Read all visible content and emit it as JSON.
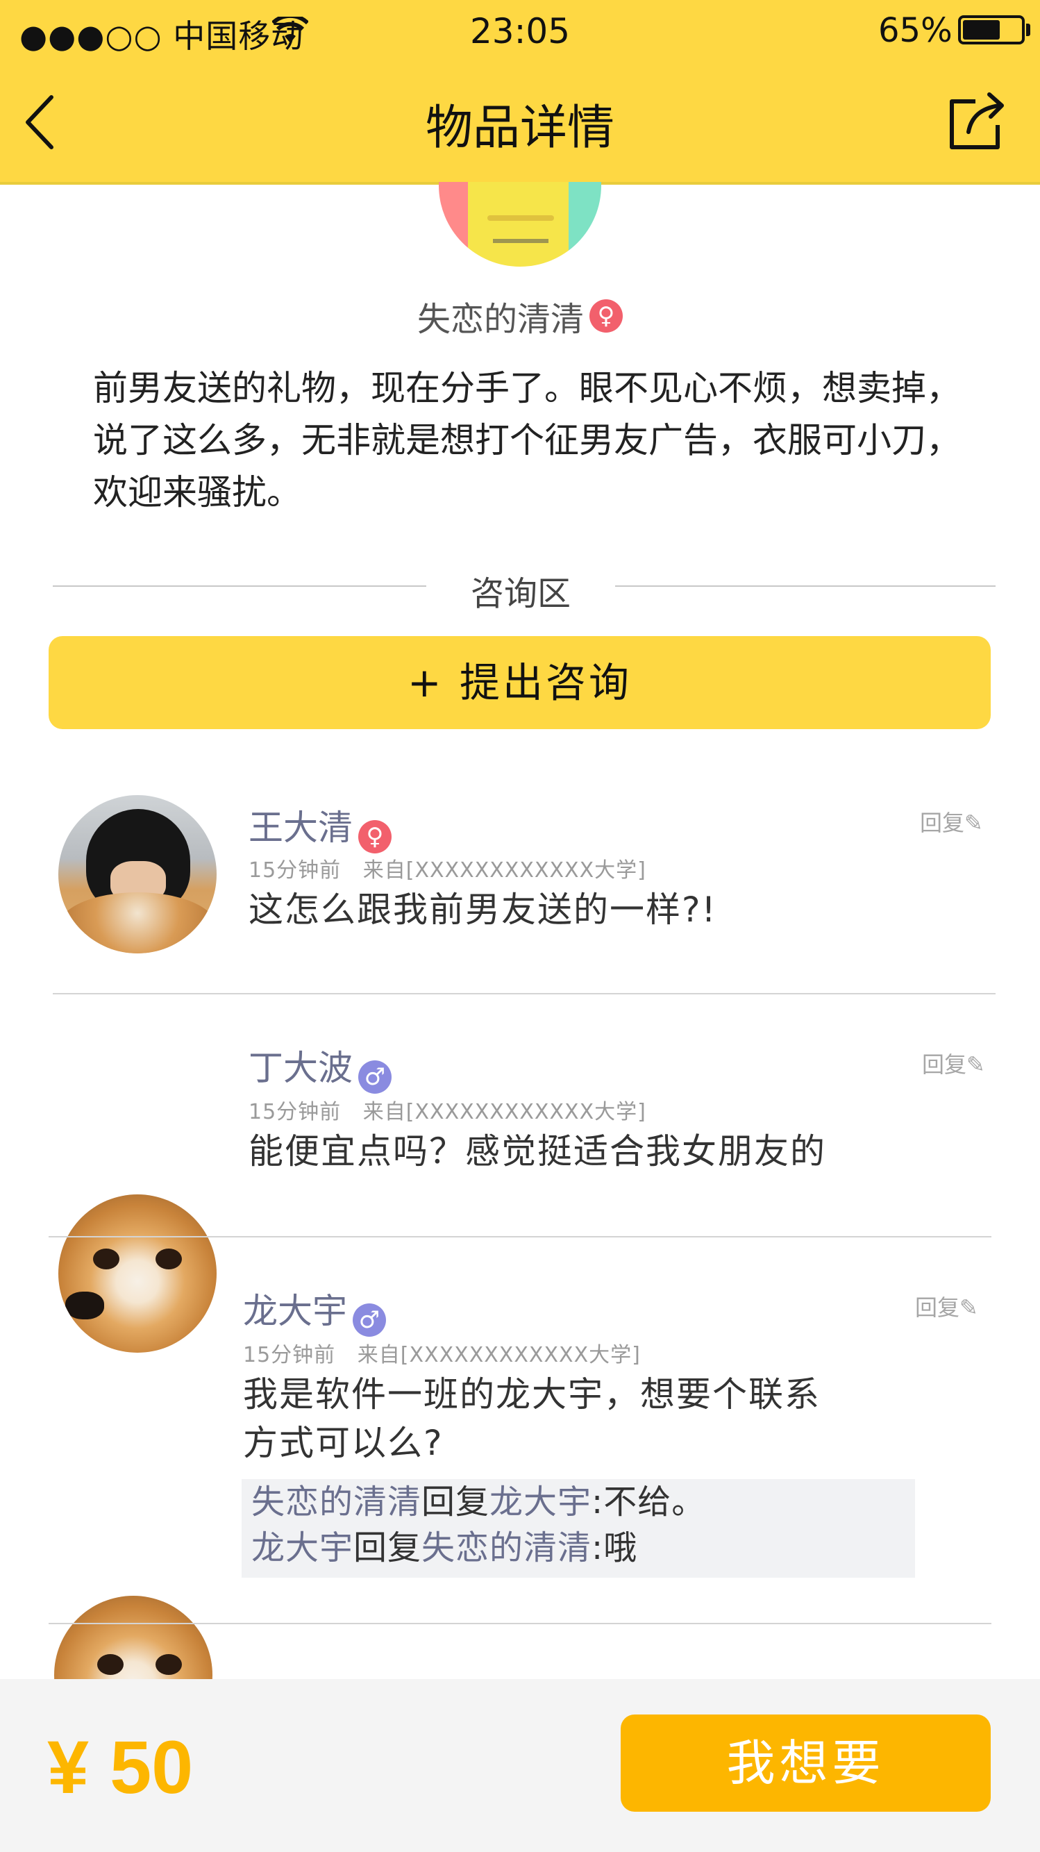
{
  "status_bar": {
    "carrier": "●●●○○ 中国移动",
    "time": "23:05",
    "battery": "65%",
    "battery_level": 0.65
  },
  "nav": {
    "title": "物品详情",
    "back_icon": "chevron-left-icon",
    "share_icon": "share-icon"
  },
  "seller": {
    "name": "失恋的清清",
    "gender_symbol": "♀",
    "description": "前男友送的礼物，现在分手了。眼不见心不烦，想卖掉，说了这么多，无非就是想打个征男友广告，衣服可小刀，欢迎来骚扰。"
  },
  "consult": {
    "section_label": "咨询区",
    "ask_button": "+ 提出咨询"
  },
  "comments": [
    {
      "name": "王大清",
      "gender_symbol": "♀",
      "time": "15分钟前",
      "source": "来自[XXXXXXXXXXXX大学]",
      "text": "这怎么跟我前男友送的一样?!",
      "reply_label": "回复"
    },
    {
      "name": "丁大波",
      "gender_symbol": "♂",
      "time": "15分钟前",
      "source": "来自[XXXXXXXXXXXX大学]",
      "text": "能便宜点吗？感觉挺适合我女朋友的",
      "reply_label": "回复"
    },
    {
      "name": "龙大宇",
      "gender_symbol": "♂",
      "time": "15分钟前",
      "source": "来自[XXXXXXXXXXXX大学]",
      "text_line1": "我是软件一班的龙大宇，想要个联系",
      "text_line2": "方式可以么?",
      "reply_label": "回复",
      "replies": [
        {
          "from": "失恋的清清",
          "verb": "回复",
          "to": "龙大宇",
          "content": ":不给。"
        },
        {
          "from": "龙大宇",
          "verb": "回复",
          "to": "失恋的清清",
          "content": ":哦"
        }
      ]
    }
  ],
  "bottom": {
    "price": "¥ 50",
    "want_button": "我想要"
  },
  "colors": {
    "header_yellow": "#FED843",
    "price_orange": "#FDB600",
    "female_pink": "#F2606C",
    "male_purple": "#8A8BE0",
    "username_slate": "#6A6F8E"
  }
}
